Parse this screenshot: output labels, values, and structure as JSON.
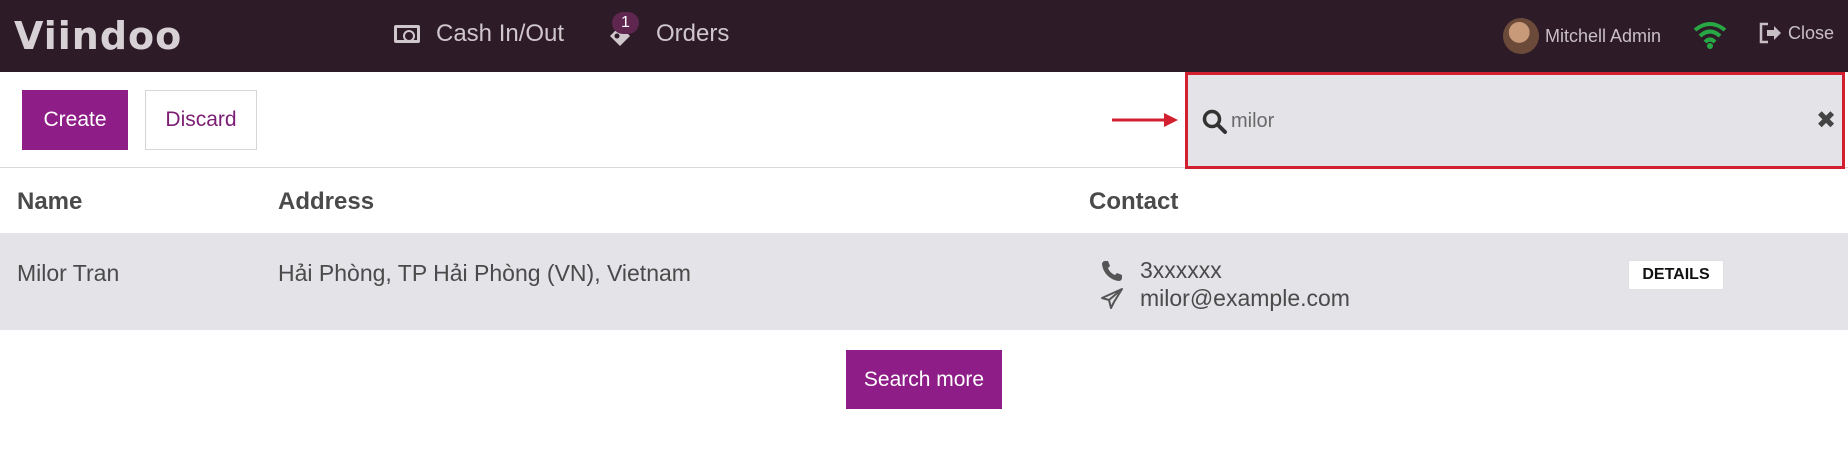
{
  "navbar": {
    "logo": "Viindoo",
    "cash_label": "Cash In/Out",
    "orders_label": "Orders",
    "orders_badge": "1",
    "user_name": "Mitchell Admin",
    "close_label": "Close"
  },
  "controls": {
    "create_label": "Create",
    "discard_label": "Discard"
  },
  "search": {
    "value": "milor"
  },
  "table": {
    "headers": {
      "name": "Name",
      "address": "Address",
      "contact": "Contact"
    },
    "rows": [
      {
        "name": "Milor Tran",
        "address": "Hải Phòng, TP Hải Phòng (VN), Vietnam",
        "phone": "3xxxxxx",
        "email": "milor@example.com",
        "details_label": "DETAILS"
      }
    ]
  },
  "footer": {
    "search_more_label": "Search more"
  },
  "colors": {
    "navbar_bg": "#2e1b28",
    "primary": "#8e1d87",
    "row_bg": "#e3e3e8",
    "highlight": "#d32030",
    "wifi": "#27a844"
  },
  "icons": [
    "cash-icon",
    "orders-icon",
    "wifi-icon",
    "sign-out-icon",
    "search-icon",
    "close-icon",
    "phone-icon",
    "paper-plane-icon",
    "arrow-icon"
  ]
}
